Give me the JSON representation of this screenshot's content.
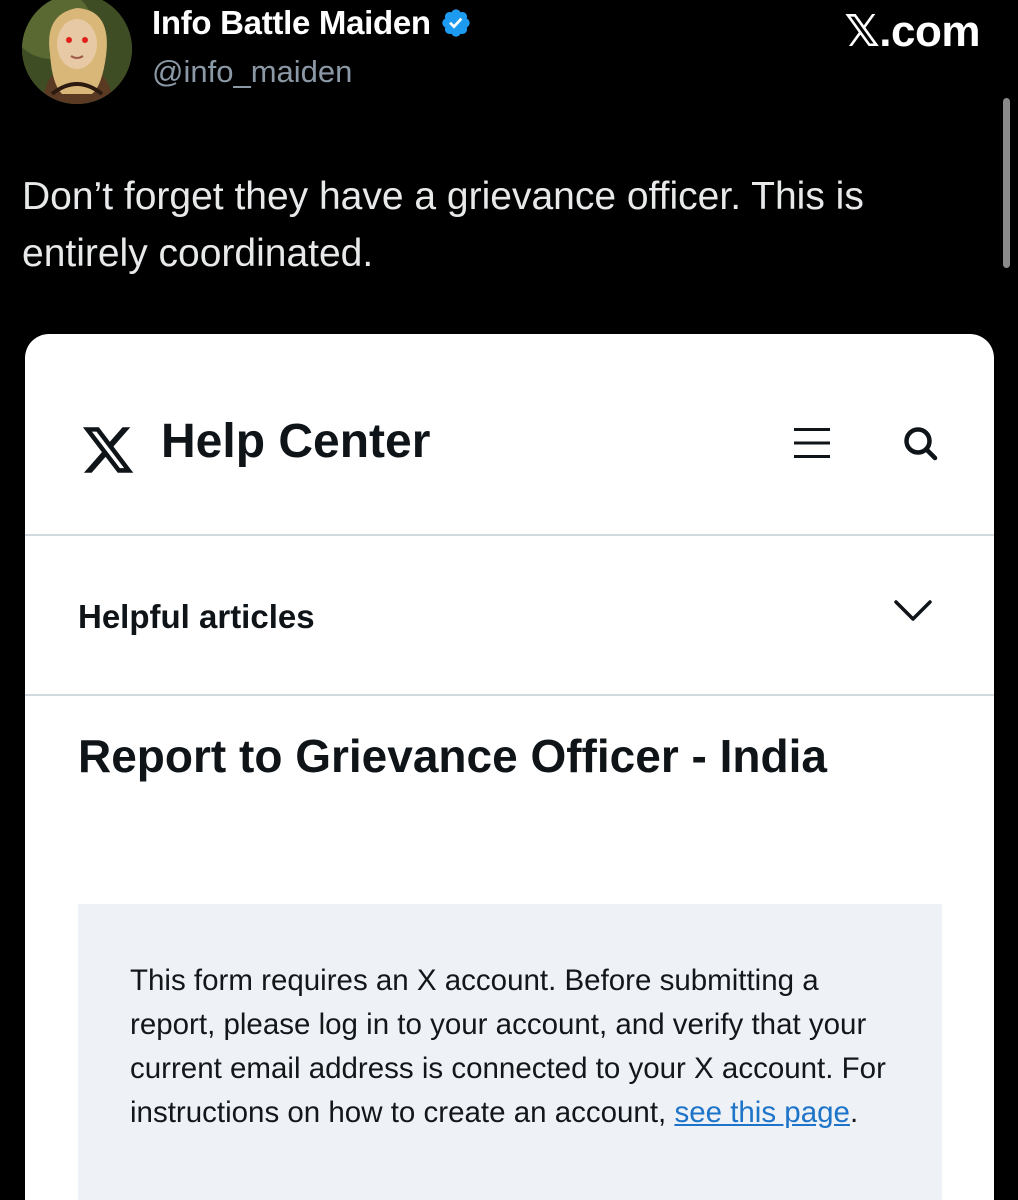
{
  "tweet": {
    "author": {
      "display_name": "Info Battle Maiden",
      "handle": "@info_maiden",
      "verified": true,
      "avatar_icon": "avatar-portrait"
    },
    "brand": "𝕏.com",
    "text": "Don’t forget they have a grievance officer. This is entirely coordinated."
  },
  "help_center": {
    "logo_icon": "x-logo-icon",
    "title": "Help Center",
    "menu_icon": "hamburger-menu-icon",
    "search_icon": "search-icon",
    "helpful_articles_label": "Helpful articles",
    "dropdown_icon": "chevron-down-icon",
    "heading": "Report to Grievance Officer - India",
    "notice": {
      "text_before_link": "This form requires an X account. Before submitting a report, please log in to your account, and verify that your current email address is connected to your X account. For instructions on how to create an account, ",
      "link_text": "see this page",
      "text_after_link": "."
    }
  },
  "colors": {
    "background": "#000000",
    "verified_badge": "#1d9bf0",
    "handle_gray": "#8b98a5",
    "link_blue": "#1d74c9",
    "notice_bg": "#eef1f5"
  }
}
